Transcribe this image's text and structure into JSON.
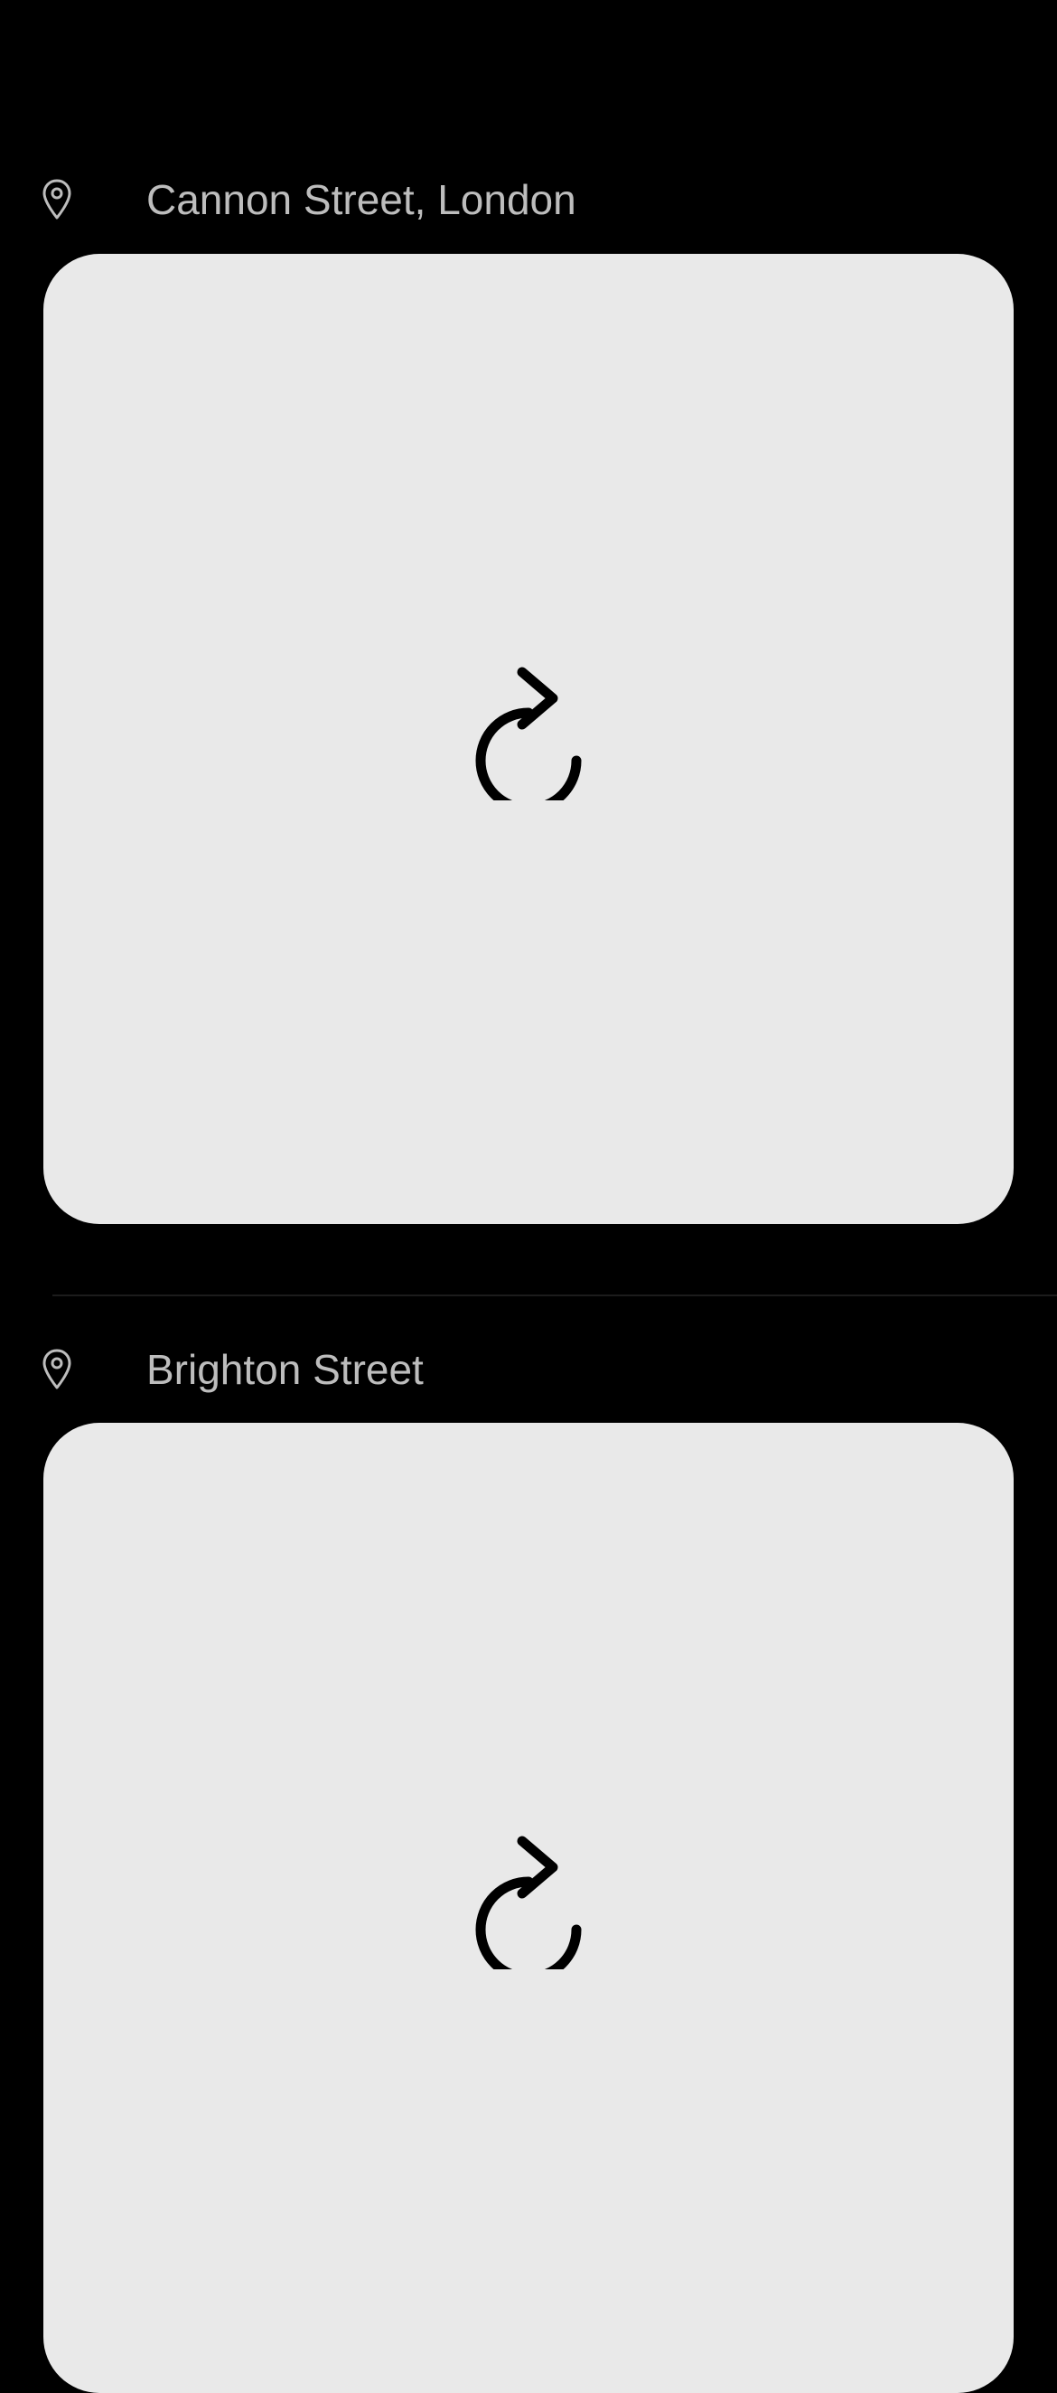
{
  "colors": {
    "background": "#000000",
    "card": "#e9e9e9",
    "label": "#bdbdbd",
    "icon": "#000000"
  },
  "posts": [
    {
      "location": "Cannon Street, London",
      "location_icon": "map-pin-icon",
      "placeholder_icon": "reload-icon"
    },
    {
      "location": "Brighton Street",
      "location_icon": "map-pin-icon",
      "placeholder_icon": "reload-icon"
    }
  ]
}
